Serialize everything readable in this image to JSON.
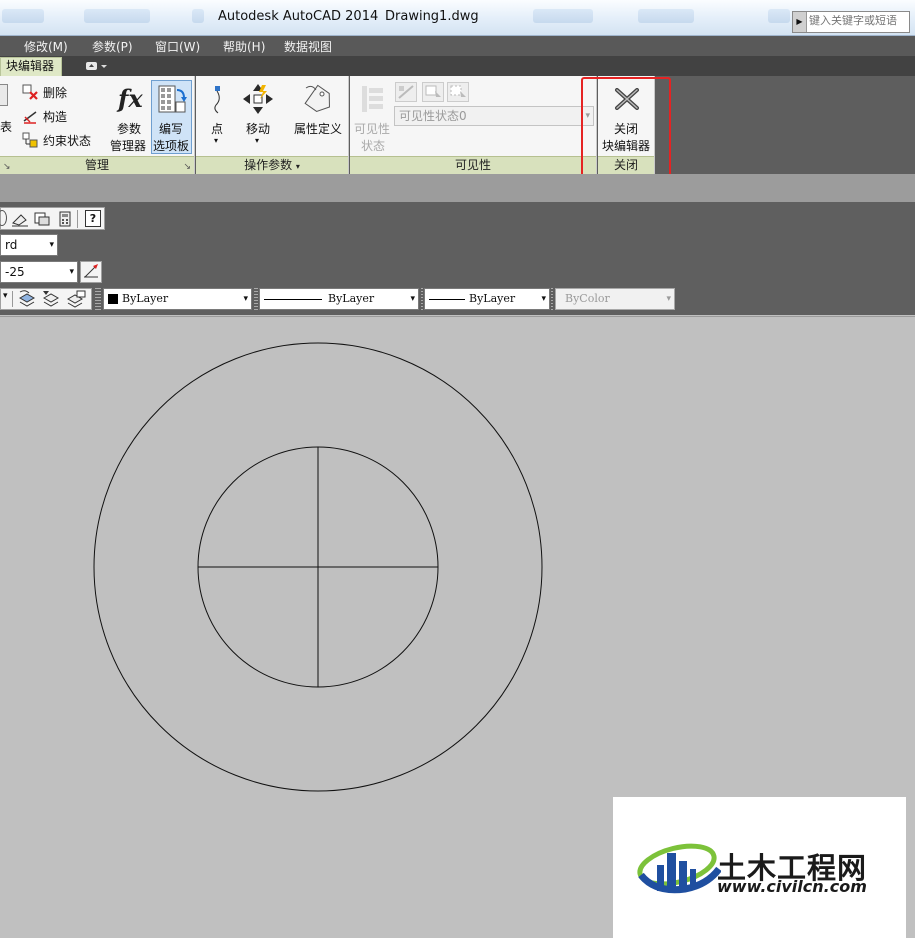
{
  "titlebar": {
    "app_title": "Autodesk AutoCAD 2014",
    "file_name": "Drawing1.dwg",
    "search_placeholder": "键入关键字或短语"
  },
  "menubar": {
    "items": [
      "修改(M)",
      "参数(P)",
      "窗口(W)",
      "帮助(H)",
      "数据视图"
    ]
  },
  "ribbon_tabs": {
    "active": "块编辑器"
  },
  "ribbon": {
    "manage_panel": {
      "footer": "管理",
      "delete": "删除",
      "construct": "构造",
      "constraint_status": "约束状态",
      "param_manager_1": "参数",
      "param_manager_2": "管理器",
      "authoring_palettes_1": "编写",
      "authoring_palettes_2": "选项板",
      "cut_off_char": "表"
    },
    "action_params_panel": {
      "footer": "操作参数",
      "point": "点",
      "move": "移动",
      "attribute_def": "属性定义"
    },
    "visibility_panel": {
      "footer": "可见性",
      "visibility_states_1": "可见性",
      "visibility_states_2": "状态",
      "visibility_state_value": "可见性状态0"
    },
    "close_panel": {
      "footer": "关闭",
      "close_1": "关闭",
      "close_2": "块编辑器"
    }
  },
  "properties_toolbar": {
    "style_combo_value": "rd",
    "dim_style_combo_value": "-25",
    "color_combo": "ByLayer",
    "linetype_combo": "ByLayer",
    "lineweight_combo": "ByLayer",
    "plotstyle_combo": "ByColor"
  },
  "watermark": {
    "title": "土木工程网",
    "url": "www.civilcn.com"
  },
  "colors": {
    "highlight": "#e52323",
    "panel_footer": "#d8e1bd",
    "canvas": "#c0c0c0",
    "menubar": "#595959"
  },
  "icons": [
    "delete-icon",
    "construct-icon",
    "constraint-status-icon",
    "fx-icon",
    "authoring-palettes-icon",
    "point-icon",
    "move-icon",
    "attribute-tag-icon",
    "visibility-states-icon",
    "close-x-icon",
    "help-icon",
    "layer-icons"
  ]
}
